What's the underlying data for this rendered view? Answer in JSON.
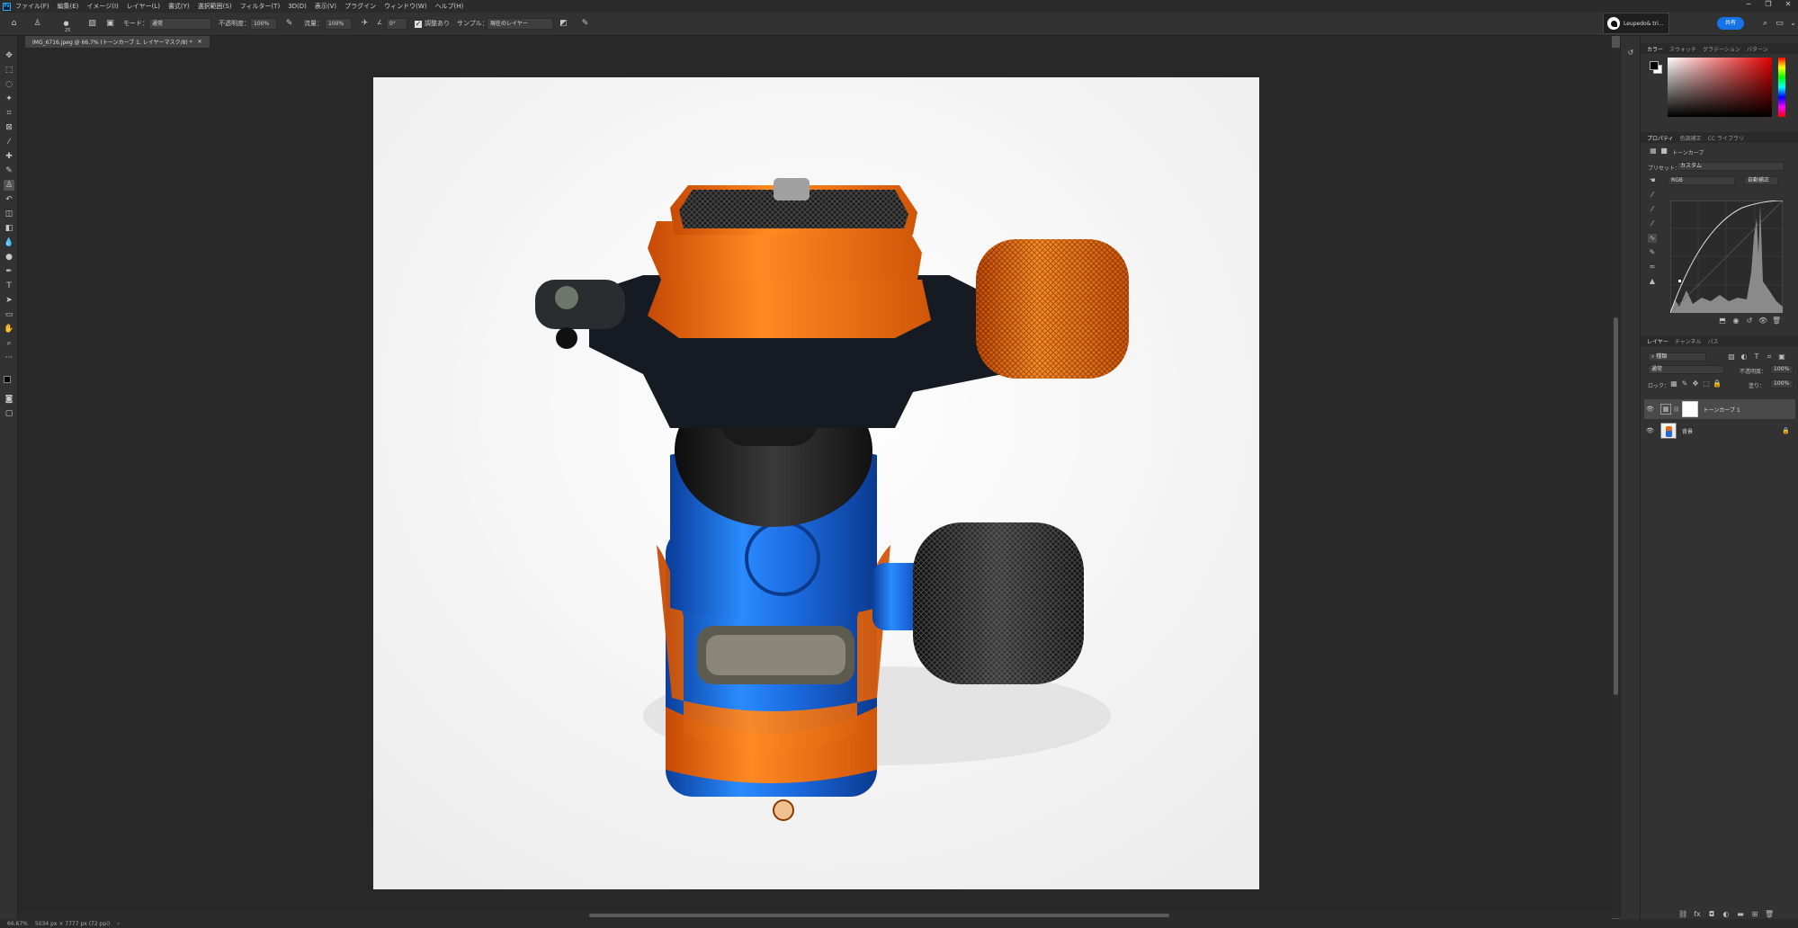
{
  "menubar": {
    "items": [
      "ファイル(F)",
      "編集(E)",
      "イメージ(I)",
      "レイヤー(L)",
      "書式(Y)",
      "選択範囲(S)",
      "フィルター(T)",
      "3D(D)",
      "表示(V)",
      "プラグイン",
      "ウィンドウ(W)",
      "ヘルプ(H)"
    ]
  },
  "options": {
    "brush_size": "25",
    "mode_label": "モード：",
    "mode_value": "通常",
    "opacity_label": "不透明度：",
    "opacity_value": "100%",
    "flow_label": "流量：",
    "flow_value": "100%",
    "angle_value": "0°",
    "aligned_label": "調整あり",
    "sample_label": "サンプル：",
    "sample_value": "現在のレイヤー",
    "share_label": "共有"
  },
  "notification": {
    "text": "Leupedo& tri..."
  },
  "document": {
    "tab_title": "IMG_6716.jpeg @ 66.7% (トーンカーブ 1, レイヤーマスク/8) *"
  },
  "status": {
    "zoom": "66.67%",
    "dimensions": "5034 px × 7777 px (72 ppi)"
  },
  "color_panel": {
    "tabs": [
      "カラー",
      "スウォッチ",
      "グラデーション",
      "パターン"
    ],
    "foreground": "#000000",
    "background": "#ffffff"
  },
  "properties_panel": {
    "tabs": [
      "プロパティ",
      "色調補正",
      "CC ライブラリ"
    ],
    "title": "トーンカーブ",
    "preset_label": "プリセット：",
    "preset_value": "カスタム",
    "channel_value": "RGB",
    "auto_label": "自動補正"
  },
  "layers_panel": {
    "tabs": [
      "レイヤー",
      "チャンネル",
      "パス"
    ],
    "kind_value": "種類",
    "blend_value": "通常",
    "opacity_label": "不透明度：",
    "opacity_value": "100%",
    "lock_label": "ロック：",
    "fill_label": "塗り：",
    "fill_value": "100%",
    "layers": [
      {
        "name": "トーンカーブ 1"
      },
      {
        "name": "背景"
      }
    ]
  }
}
